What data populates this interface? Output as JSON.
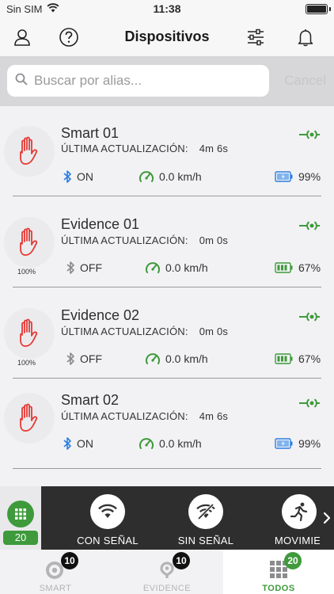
{
  "status_bar": {
    "carrier": "Sin SIM",
    "time": "11:38"
  },
  "header": {
    "title": "Dispositivos"
  },
  "search": {
    "placeholder": "Buscar por alias...",
    "value": "",
    "cancel_label": "Cancel"
  },
  "devices": [
    {
      "name": "Smart 01",
      "update_label": "ÚLTIMA ACTUALIZACIÓN:",
      "update_value": "4m 6s",
      "bluetooth": "ON",
      "speed": "0.0 km/h",
      "battery": "99%",
      "battery_kind": "charging",
      "avatar_caption": ""
    },
    {
      "name": "Evidence 01",
      "update_label": "ÚLTIMA ACTUALIZACIÓN:",
      "update_value": "0m 0s",
      "bluetooth": "OFF",
      "speed": "0.0 km/h",
      "battery": "67%",
      "battery_kind": "level",
      "avatar_caption": "100%"
    },
    {
      "name": "Evidence 02",
      "update_label": "ÚLTIMA ACTUALIZACIÓN:",
      "update_value": "0m 0s",
      "bluetooth": "OFF",
      "speed": "0.0 km/h",
      "battery": "67%",
      "battery_kind": "level",
      "avatar_caption": "100%"
    },
    {
      "name": "Smart 02",
      "update_label": "ÚLTIMA ACTUALIZACIÓN:",
      "update_value": "4m 6s",
      "bluetooth": "ON",
      "speed": "0.0 km/h",
      "battery": "99%",
      "battery_kind": "charging",
      "avatar_caption": ""
    }
  ],
  "filters": {
    "all_count": "20",
    "items": [
      {
        "label": "CON SEÑAL",
        "icon": "wifi-icon"
      },
      {
        "label": "SIN SEÑAL",
        "icon": "no-signal-icon"
      },
      {
        "label": "MOVIMIEI",
        "icon": "running-person-icon"
      }
    ]
  },
  "tabs": [
    {
      "label": "SMART",
      "badge": "10",
      "icon": "smart-device-icon"
    },
    {
      "label": "EVIDENCE",
      "badge": "10",
      "icon": "evidence-device-icon"
    },
    {
      "label": "TODOS",
      "badge": "20",
      "icon": "grid-icon"
    }
  ],
  "colors": {
    "accent_green": "#3e9a3b",
    "bluetooth_on": "#2a7de1",
    "bluetooth_off": "#8a8a8a",
    "alert_red": "#e53935",
    "filter_bar": "#2e2e2e"
  }
}
